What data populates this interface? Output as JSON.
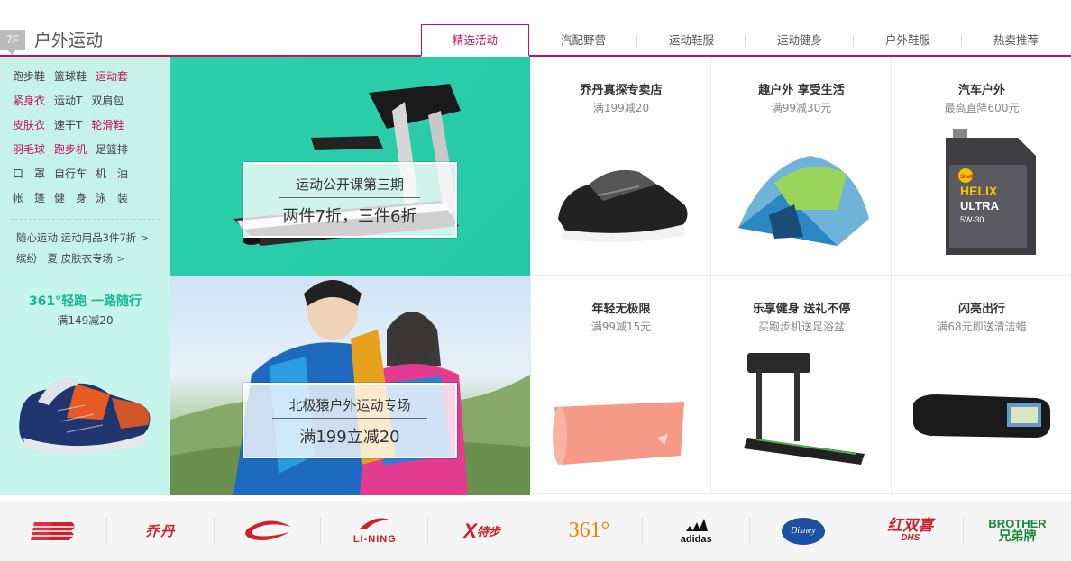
{
  "floor": {
    "badge": "7F",
    "title": "户外运动"
  },
  "tabs": [
    "精选活动",
    "汽配野营",
    "运动鞋服",
    "运动健身",
    "户外鞋服",
    "热卖推荐"
  ],
  "category_links": [
    [
      "跑步鞋",
      "篮球鞋",
      "运动套"
    ],
    [
      "紧身衣",
      "运动T",
      "双肩包"
    ],
    [
      "皮肤衣",
      "速干T",
      "轮滑鞋"
    ],
    [
      "羽毛球",
      "跑步机",
      "足篮排"
    ],
    [
      "口　罩",
      "自行车",
      "机　油"
    ],
    [
      "帐　篷",
      "健　身",
      "泳　装"
    ]
  ],
  "promo_links": [
    {
      "text": "随心运动 运动用品3件7折",
      "arrow": ">"
    },
    {
      "text": "缤纷一夏 皮肤衣专场",
      "arrow": ">"
    }
  ],
  "side_promo": {
    "title": "361°轻跑 一路随行",
    "subtitle": "满149减20"
  },
  "banners": [
    {
      "title": "运动公开课第三期",
      "offer": "两件7折，三件6折"
    },
    {
      "title": "北极猿户外运动专场",
      "offer": "满199立减20"
    }
  ],
  "products": [
    {
      "title": "乔丹真探专卖店",
      "subtitle": "满199减20",
      "image": "black-running-shoe"
    },
    {
      "title": "趣户外 享受生活",
      "subtitle": "满99减30元",
      "image": "camping-tent"
    },
    {
      "title": "汽车户外",
      "subtitle": "最高直降600元",
      "image": "shell-helix-oil"
    },
    {
      "title": "年轻无极限",
      "subtitle": "满99减15元",
      "image": "yoga-mat"
    },
    {
      "title": "乐享健身 送礼不停",
      "subtitle": "买跑步机送足浴盆",
      "image": "treadmill"
    },
    {
      "title": "闪亮出行",
      "subtitle": "满68元即送清洁蜡",
      "image": "rearview-mirror-dvr"
    }
  ],
  "oil_label": {
    "brand": "Shell",
    "line1": "HELIX",
    "line2": "ULTRA",
    "grade": "5W-30"
  },
  "brands": [
    {
      "name": "NB",
      "color": "#d0202a"
    },
    {
      "name": "乔丹",
      "color": "#d0202a"
    },
    {
      "name": "",
      "color": "#d0202a"
    },
    {
      "name": "LI-NING",
      "color": "#d0202a"
    },
    {
      "name": "特步",
      "color": "#d0202a"
    },
    {
      "name": "361°",
      "color": "#f08300"
    },
    {
      "name": "adidas",
      "color": "#111111"
    },
    {
      "name": "Disney",
      "color": "#1d4fa3"
    },
    {
      "name": "红双喜",
      "color": "#d0202a"
    },
    {
      "name": "BROTHER",
      "sub": "兄弟牌",
      "color": "#1a8a3a"
    }
  ],
  "colors": {
    "accent": "#c1145e",
    "teal": "#2ed0ac",
    "mint": "#c6f2ea"
  }
}
